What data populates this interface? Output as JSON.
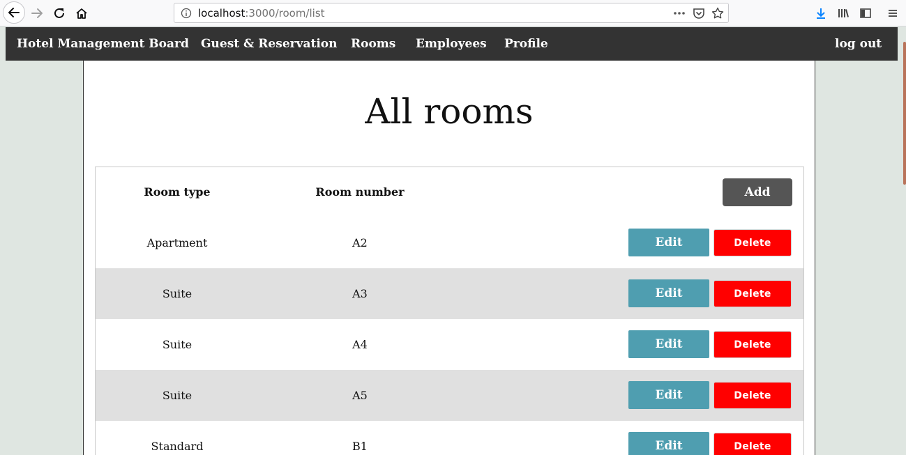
{
  "browser": {
    "url_host": "localhost",
    "url_rest": ":3000/room/list"
  },
  "nav": {
    "brand": "Hotel Management Board",
    "items": [
      "Guest & Reservation",
      "Rooms",
      "Employees",
      "Profile"
    ],
    "logout": "log out"
  },
  "page": {
    "title": "All rooms"
  },
  "table": {
    "headers": {
      "room_type": "Room type",
      "room_number": "Room number"
    },
    "add_label": "Add",
    "edit_label": "Edit",
    "delete_label": "Delete",
    "rows": [
      {
        "type": "Apartment",
        "number": "A2"
      },
      {
        "type": "Suite",
        "number": "A3"
      },
      {
        "type": "Suite",
        "number": "A4"
      },
      {
        "type": "Suite",
        "number": "A5"
      },
      {
        "type": "Standard",
        "number": "B1"
      }
    ]
  },
  "colors": {
    "navbar": "#333333",
    "edit": "#4f9eb0",
    "delete": "#ff0000",
    "add": "#555555",
    "row_alt": "#e0e0e0"
  },
  "icons": [
    "back-icon",
    "forward-icon",
    "reload-icon",
    "home-icon",
    "info-icon",
    "more-icon",
    "pocket-icon",
    "bookmark-star-icon",
    "download-icon",
    "library-icon",
    "sidebar-icon",
    "menu-icon"
  ]
}
